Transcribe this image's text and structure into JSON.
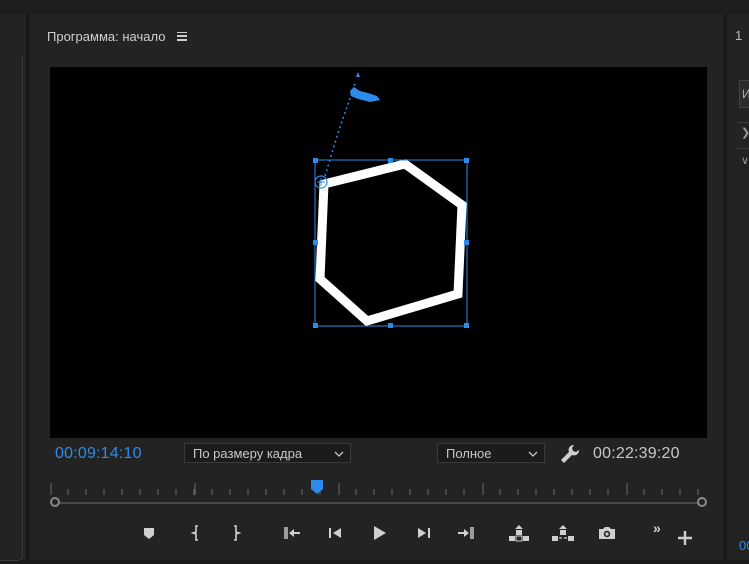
{
  "panel": {
    "title": "Программа: начало"
  },
  "timecode": {
    "current": "00:09:14:10",
    "duration": "00:22:39:20"
  },
  "zoom_select": {
    "value": "По размеру кадра"
  },
  "quality_select": {
    "value": "Полное"
  },
  "playback": {
    "playhead_fraction": 0.408
  },
  "right_panel": {
    "tab_partial": "1",
    "field_partial": "И",
    "time_partial": "00"
  },
  "colors": {
    "accent": "#2d8ceb",
    "panel_bg": "#232323",
    "viewer_bg": "#000000",
    "shape_stroke": "#ffffff"
  },
  "buttons": [
    {
      "name": "add-marker-button",
      "icon": "marker-icon"
    },
    {
      "name": "mark-in-button",
      "icon": "mark-in-icon"
    },
    {
      "name": "mark-out-button",
      "icon": "mark-out-icon"
    },
    {
      "name": "go-to-in-button",
      "icon": "go-to-in-icon"
    },
    {
      "name": "step-back-button",
      "icon": "step-back-icon"
    },
    {
      "name": "play-button",
      "icon": "play-icon"
    },
    {
      "name": "step-forward-button",
      "icon": "step-forward-icon"
    },
    {
      "name": "go-to-out-button",
      "icon": "go-to-out-icon"
    },
    {
      "name": "lift-button",
      "icon": "lift-icon"
    },
    {
      "name": "extract-button",
      "icon": "extract-icon"
    },
    {
      "name": "export-frame-button",
      "icon": "camera-icon"
    },
    {
      "name": "more-controls-button",
      "icon": "chevrons-right-icon"
    },
    {
      "name": "button-editor-button",
      "icon": "plus-icon"
    }
  ]
}
